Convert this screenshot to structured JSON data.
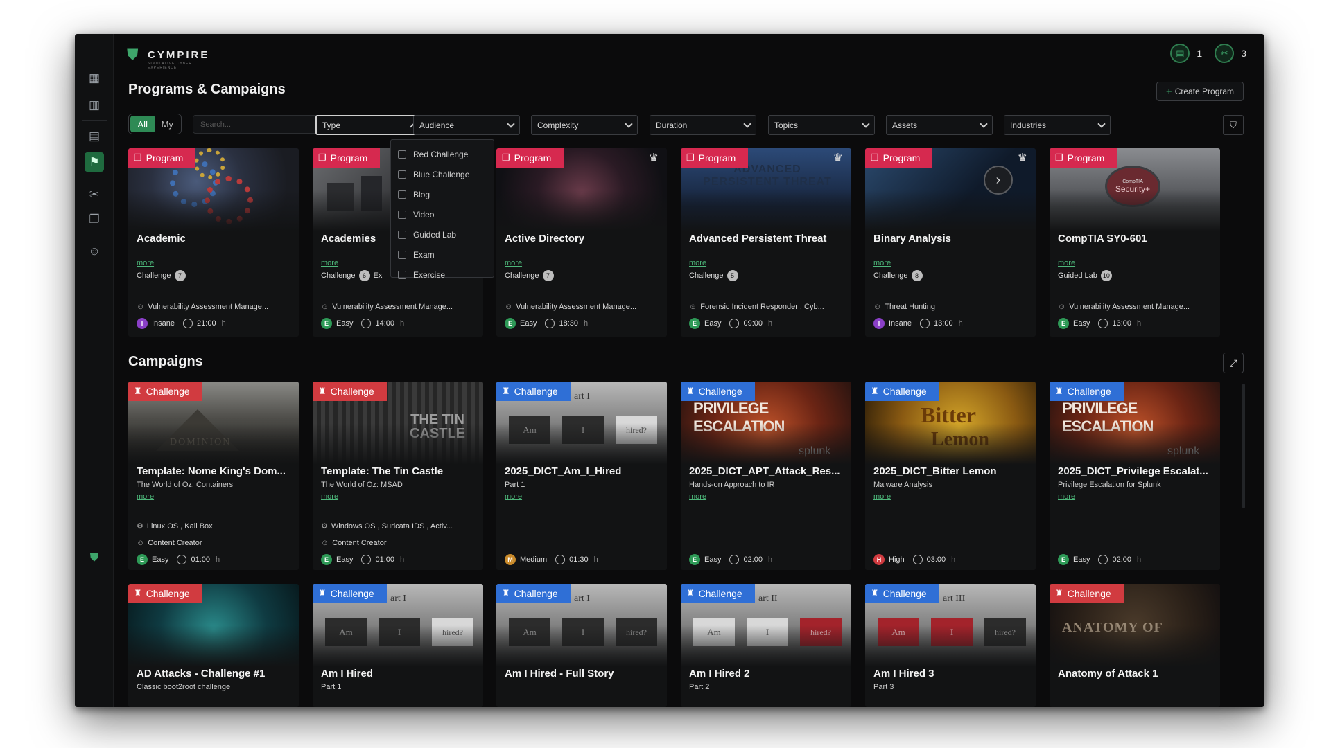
{
  "brand": {
    "name": "CYMPIRE",
    "tagline": "SIMULATIVE CYBER EXPERIENCE"
  },
  "top_counters": [
    {
      "icon": "calendar-icon",
      "value": "1"
    },
    {
      "icon": "tools-icon",
      "value": "3"
    }
  ],
  "header": {
    "title": "Programs & Campaigns",
    "create_label": "Create Program"
  },
  "filters": {
    "toggle": {
      "all": "All",
      "my": "My"
    },
    "search_placeholder": "Search...",
    "selects": [
      "Type",
      "Audience",
      "Complexity",
      "Duration",
      "Topics",
      "Assets",
      "Industries"
    ],
    "type_options": [
      "Red Challenge",
      "Blue Challenge",
      "Blog",
      "Video",
      "Guided Lab",
      "Exam",
      "Exercise"
    ]
  },
  "programs": [
    {
      "badge": "Program",
      "title": "Academic",
      "more": "more",
      "ctype": "Challenge",
      "count": "7",
      "audience": "Vulnerability Assessment Manage...",
      "level": "Insane",
      "lvl": "I",
      "duration": "21:00",
      "unit": "h"
    },
    {
      "badge": "Program",
      "title": "Academies",
      "more": "more",
      "ctype": "Challenge",
      "count": "6",
      "extra": "Ex",
      "audience": "Vulnerability Assessment Manage...",
      "level": "Easy",
      "lvl": "E",
      "duration": "14:00",
      "unit": "h"
    },
    {
      "badge": "Program",
      "title": "Active Directory",
      "more": "more",
      "ctype": "Challenge",
      "count": "7",
      "audience": "Vulnerability Assessment Manage...",
      "level": "Easy",
      "lvl": "E",
      "duration": "18:30",
      "unit": "h"
    },
    {
      "badge": "Program",
      "title": "Advanced Persistent Threat",
      "more": "more",
      "ctype": "Challenge",
      "count": "5",
      "audience": "Forensic Incident Responder , Cyb...",
      "level": "Easy",
      "lvl": "E",
      "duration": "09:00",
      "unit": "h"
    },
    {
      "badge": "Program",
      "title": "Binary Analysis",
      "more": "more",
      "ctype": "Challenge",
      "count": "8",
      "audience": "Threat Hunting",
      "level": "Insane",
      "lvl": "I",
      "duration": "13:00",
      "unit": "h"
    },
    {
      "badge": "Program",
      "title": "CompTIA SY0-601",
      "more": "more",
      "ctype": "Guided Lab",
      "count": "10",
      "audience": "Vulnerability Assessment Manage...",
      "level": "Easy",
      "lvl": "E",
      "duration": "13:00",
      "unit": "h"
    }
  ],
  "campaigns_title": "Campaigns",
  "campaigns": [
    {
      "badge": "Challenge",
      "color": "red",
      "title": "Template: Nome King's Dom...",
      "sub": "The World of Oz: Containers",
      "more": "more",
      "assets": "Linux OS , Kali Box",
      "audience": "Content Creator",
      "level": "Easy",
      "lvl": "E",
      "duration": "01:00",
      "unit": "h"
    },
    {
      "badge": "Challenge",
      "color": "red",
      "title": "Template: The Tin Castle",
      "sub": "The World of Oz: MSAD",
      "more": "more",
      "assets": "Windows OS , Suricata IDS , Activ...",
      "audience": "Content Creator",
      "level": "Easy",
      "lvl": "E",
      "duration": "01:00",
      "unit": "h"
    },
    {
      "badge": "Challenge",
      "color": "blue",
      "title": "2025_DICT_Am_I_Hired",
      "sub": "Part 1",
      "more": "more",
      "assets": "",
      "audience": "",
      "level": "Medium",
      "lvl": "M",
      "duration": "01:30",
      "unit": "h"
    },
    {
      "badge": "Challenge",
      "color": "blue",
      "title": "2025_DICT_APT_Attack_Res...",
      "sub": "Hands-on Approach to IR",
      "more": "more",
      "assets": "",
      "audience": "",
      "level": "Easy",
      "lvl": "E",
      "duration": "02:00",
      "unit": "h"
    },
    {
      "badge": "Challenge",
      "color": "blue",
      "title": "2025_DICT_Bitter Lemon",
      "sub": "Malware Analysis",
      "more": "more",
      "assets": "",
      "audience": "",
      "level": "High",
      "lvl": "H",
      "duration": "03:00",
      "unit": "h"
    },
    {
      "badge": "Challenge",
      "color": "blue",
      "title": "2025_DICT_Privilege Escalat...",
      "sub": "Privilege Escalation for Splunk",
      "more": "more",
      "assets": "",
      "audience": "",
      "level": "Easy",
      "lvl": "E",
      "duration": "02:00",
      "unit": "h"
    }
  ],
  "campaigns_row2": [
    {
      "badge": "Challenge",
      "color": "red",
      "title": "AD Attacks - Challenge #1",
      "sub": "Classic boot2root challenge"
    },
    {
      "badge": "Challenge",
      "color": "blue",
      "title": "Am I Hired",
      "sub": "Part 1"
    },
    {
      "badge": "Challenge",
      "color": "blue",
      "title": "Am I Hired - Full Story",
      "sub": ""
    },
    {
      "badge": "Challenge",
      "color": "blue",
      "title": "Am I Hired 2",
      "sub": "Part 2"
    },
    {
      "badge": "Challenge",
      "color": "blue",
      "title": "Am I Hired 3",
      "sub": "Part 3"
    },
    {
      "badge": "Challenge",
      "color": "red",
      "title": "Anatomy of Attack 1",
      "sub": ""
    }
  ],
  "image_texts": {
    "apt": "ADVANCED PERSISTENT THREAT",
    "security_plus": "Security+",
    "comptia": "CompTIA",
    "dominion": "DOMINION",
    "tin_castle": "THE TIN CASTLE",
    "am": "Am",
    "i": "I",
    "hired": "hired?",
    "part_i": "art I",
    "part_ii": "art II",
    "part_iii": "art III",
    "priv_esc": "PRIVILEGE ESCALATION",
    "splunk": "splunk",
    "bitter": "Bitter",
    "lemon": "Lemon",
    "anatomy": "ANATOMY OF"
  }
}
